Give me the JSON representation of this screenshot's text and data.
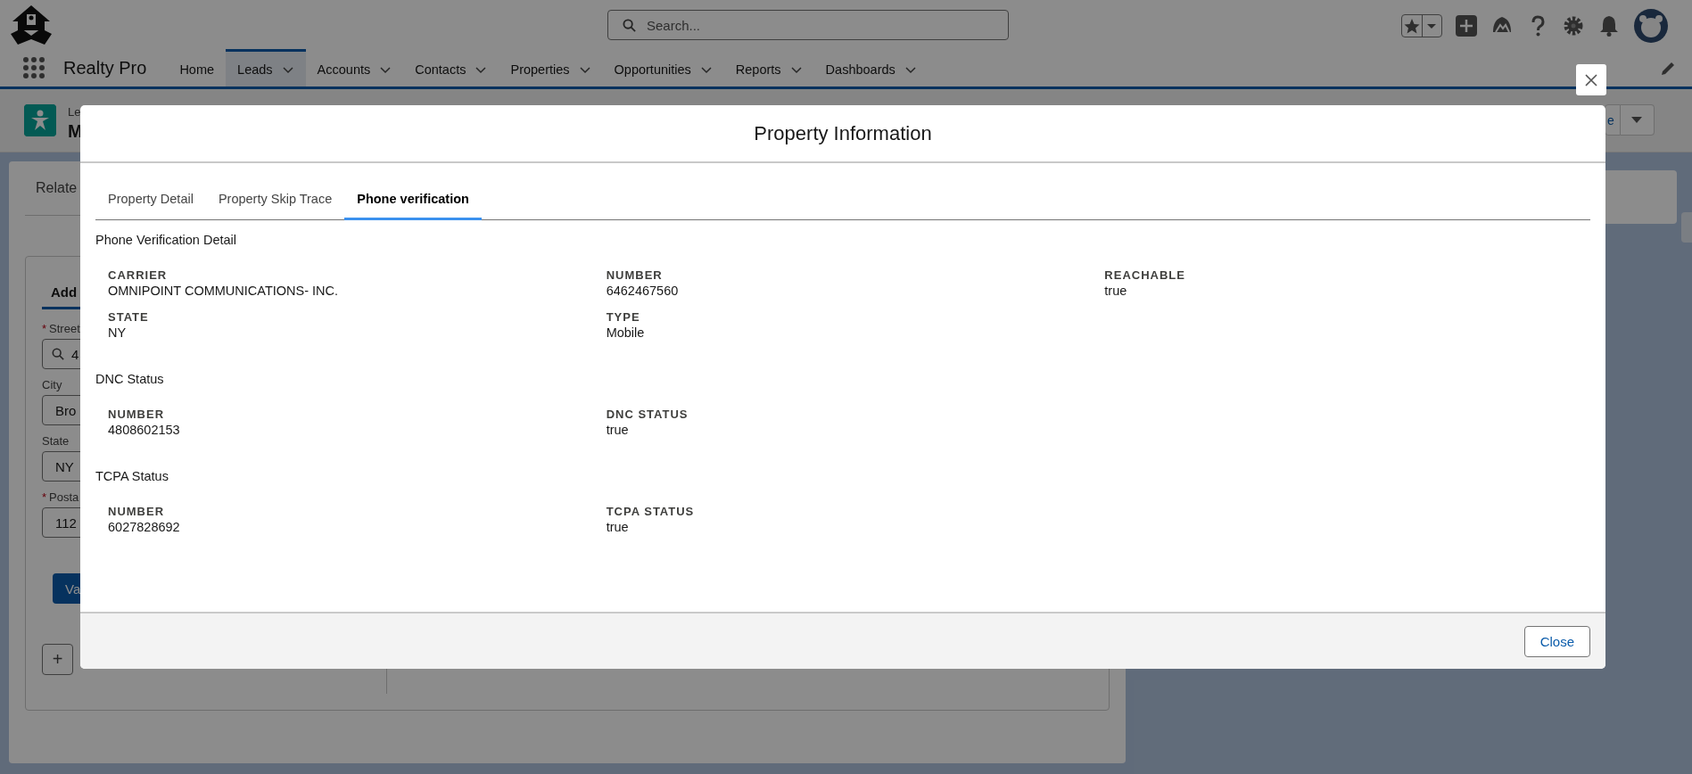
{
  "app": {
    "name": "Realty Pro",
    "search": {
      "placeholder": "Search..."
    },
    "nav": [
      {
        "label": "Home",
        "selected": false,
        "menu": false
      },
      {
        "label": "Leads",
        "selected": true,
        "menu": true
      },
      {
        "label": "Accounts",
        "selected": false,
        "menu": true
      },
      {
        "label": "Contacts",
        "selected": false,
        "menu": true
      },
      {
        "label": "Properties",
        "selected": false,
        "menu": true
      },
      {
        "label": "Opportunities",
        "selected": false,
        "menu": true
      },
      {
        "label": "Reports",
        "selected": false,
        "menu": true
      },
      {
        "label": "Dashboards",
        "selected": false,
        "menu": true
      }
    ]
  },
  "record": {
    "object_label": "Le",
    "name": "M",
    "action": "e"
  },
  "related": {
    "tab": "Relate",
    "section_tab": "Add",
    "fields": [
      {
        "marker": "*",
        "label": "Street",
        "value": "4",
        "kind": "lookup"
      },
      {
        "label": "City",
        "value": "Bro",
        "kind": "text"
      },
      {
        "label": "State",
        "value": "NY",
        "kind": "text"
      },
      {
        "marker": "*",
        "label": "Posta",
        "value": "112",
        "kind": "text"
      }
    ],
    "primary_button": "Va",
    "add_button": "+"
  },
  "modal": {
    "title": "Property Information",
    "tabs": [
      {
        "label": "Property Detail",
        "selected": false
      },
      {
        "label": "Property Skip Trace",
        "selected": false
      },
      {
        "label": "Phone verification",
        "selected": true
      }
    ],
    "sections": [
      {
        "title": "Phone Verification Detail",
        "fields": [
          {
            "label": "CARRIER",
            "value": "OMNIPOINT COMMUNICATIONS- INC."
          },
          {
            "label": "NUMBER",
            "value": "6462467560"
          },
          {
            "label": "REACHABLE",
            "value": "true"
          },
          {
            "label": "STATE",
            "value": "NY"
          },
          {
            "label": "TYPE",
            "value": "Mobile"
          }
        ]
      },
      {
        "title": "DNC Status",
        "fields": [
          {
            "label": "NUMBER",
            "value": "4808602153"
          },
          {
            "label": "DNC STATUS",
            "value": "true"
          }
        ]
      },
      {
        "title": "TCPA Status",
        "fields": [
          {
            "label": "NUMBER",
            "value": "6027828692"
          },
          {
            "label": "TCPA STATUS",
            "value": "true"
          }
        ]
      }
    ],
    "footer_button": "Close"
  }
}
